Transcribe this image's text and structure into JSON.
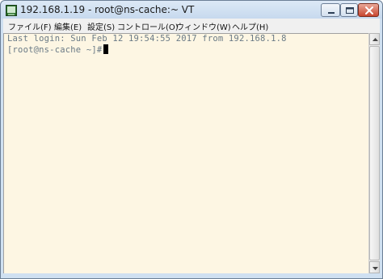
{
  "window": {
    "title": "192.168.1.19 - root@ns-cache:~ VT"
  },
  "menu": {
    "items": [
      "ファイル(F)",
      "編集(E)",
      "設定(S)",
      "コントロール(O)",
      "ウィンドウ(W)",
      "ヘルプ(H)"
    ]
  },
  "terminal": {
    "lines": [
      "Last login: Sun Feb 12 19:54:55 2017 from 192.168.1.8",
      "[root@ns-cache ~]#"
    ]
  },
  "colors": {
    "terminal_background": "#fdf6e3",
    "terminal_text": "#6a7a86",
    "titlebar": "#d3e3f4",
    "close_button": "#c8462f"
  },
  "icons": {
    "app": "terminal-app-icon",
    "minimize": "minimize-icon",
    "maximize": "maximize-icon",
    "close": "close-icon"
  }
}
